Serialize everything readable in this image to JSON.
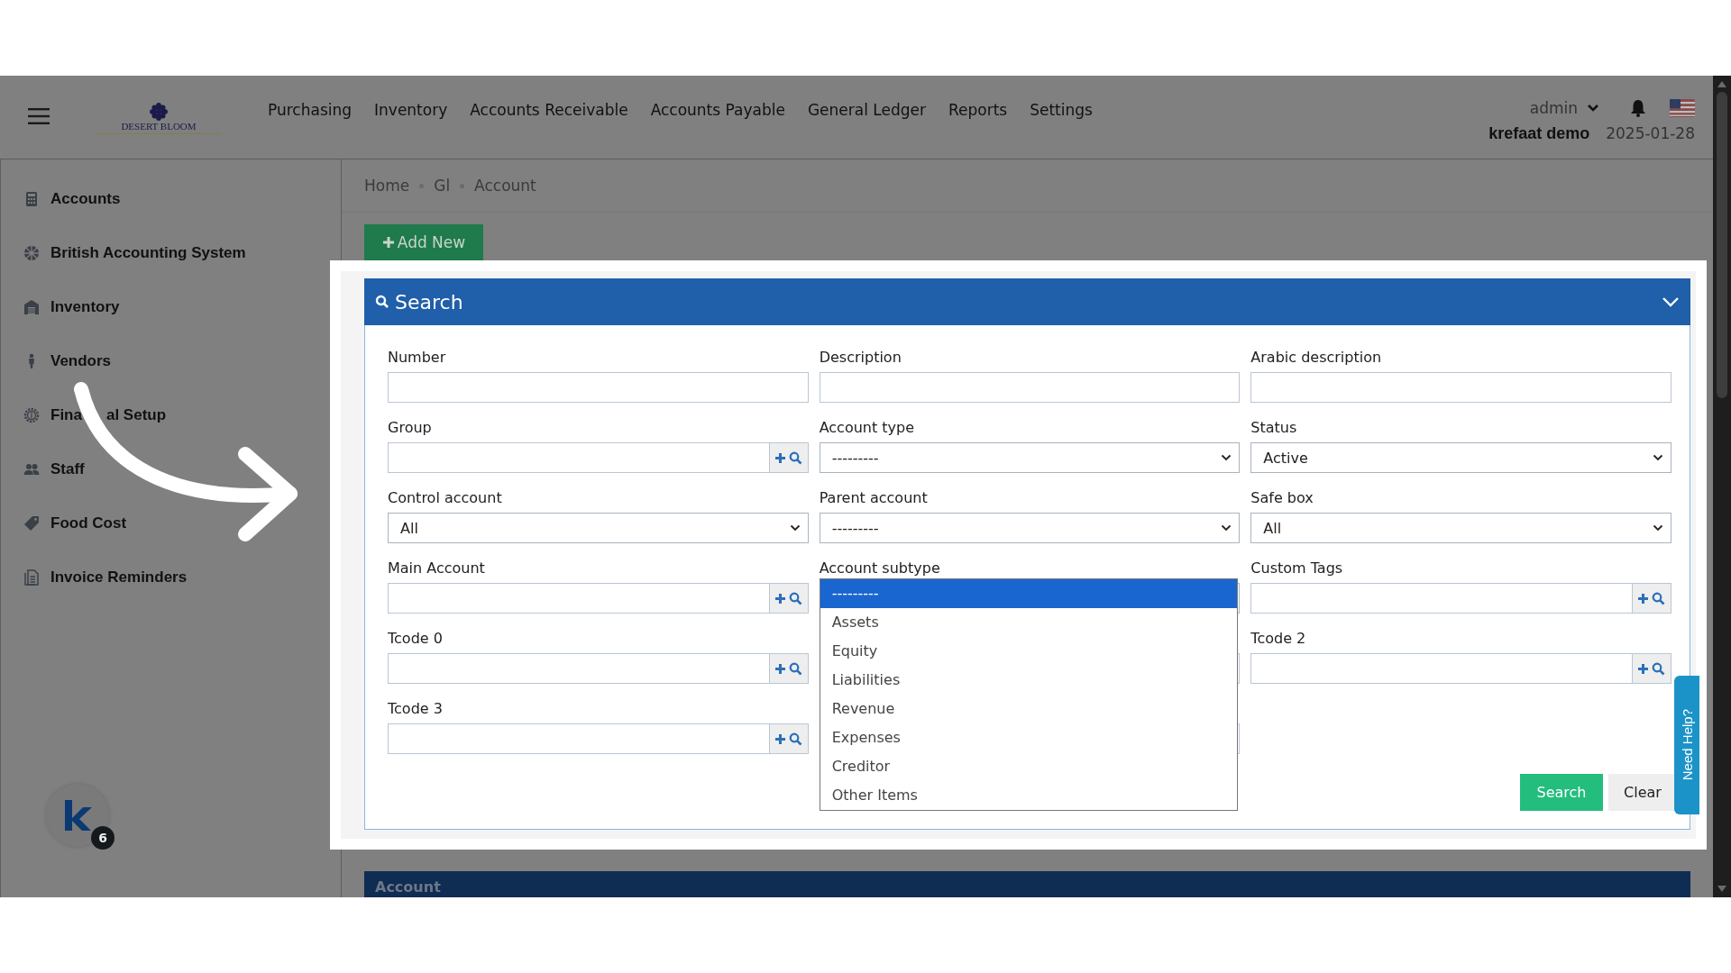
{
  "header": {
    "logo": "DESERT BLOOM",
    "nav": [
      "Purchasing",
      "Inventory",
      "Accounts Receivable",
      "Accounts Payable",
      "General Ledger",
      "Reports",
      "Settings"
    ],
    "user": "admin",
    "company": "krefaat demo",
    "date": "2025-01-28"
  },
  "sidebar": {
    "items": [
      {
        "label": "Accounts",
        "kind": "calculator"
      },
      {
        "label": "British Accounting System",
        "kind": "globe"
      },
      {
        "label": "Inventory",
        "kind": "warehouse"
      },
      {
        "label": "Vendors",
        "kind": "person"
      },
      {
        "label": "Fina",
        "label_rest": "al Setup",
        "kind": "gear"
      },
      {
        "label": "Staff",
        "kind": "people"
      },
      {
        "label": "Food Cost",
        "kind": "tag"
      },
      {
        "label": "Invoice Reminders",
        "kind": "document"
      }
    ],
    "badge": "6"
  },
  "breadcrumb": [
    "Home",
    "Gl",
    "Account"
  ],
  "add_button": "Add New",
  "search_panel": {
    "title": "Search",
    "expanded": true,
    "rows": [
      {
        "cells": [
          {
            "kind": "text",
            "label": "Number"
          },
          {
            "kind": "text",
            "label": "Description"
          },
          {
            "kind": "text",
            "label": "Arabic description"
          }
        ]
      },
      {
        "cells": [
          {
            "kind": "lookup",
            "label": "Group"
          },
          {
            "kind": "select",
            "label": "Account type",
            "value": "---------"
          },
          {
            "kind": "select",
            "label": "Status",
            "value": "Active"
          }
        ]
      },
      {
        "cells": [
          {
            "kind": "select",
            "label": "Control account",
            "value": "All"
          },
          {
            "kind": "select",
            "label": "Parent account",
            "value": "---------"
          },
          {
            "kind": "select",
            "label": "Safe box",
            "value": "All"
          }
        ]
      },
      {
        "cells": [
          {
            "kind": "lookup",
            "label": "Main Account"
          },
          {
            "kind": "open-select",
            "label": "Account subtype"
          },
          {
            "kind": "lookup",
            "label": "Custom Tags"
          }
        ]
      },
      {
        "cells": [
          {
            "kind": "lookup",
            "label": "Tcode 0"
          },
          {
            "kind": "covered"
          },
          {
            "kind": "lookup",
            "label": "Tcode 2"
          }
        ]
      },
      {
        "cells": [
          {
            "kind": "lookup",
            "label": "Tcode 3"
          },
          {
            "kind": "covered"
          }
        ]
      }
    ],
    "dropdown": {
      "options": [
        {
          "label": "---------",
          "selected": true
        },
        {
          "label": "Assets",
          "selected": false
        },
        {
          "label": "Equity",
          "selected": false
        },
        {
          "label": "Liabilities",
          "selected": false
        },
        {
          "label": "Revenue",
          "selected": false
        },
        {
          "label": "Expenses",
          "selected": false
        },
        {
          "label": "Creditor",
          "selected": false
        },
        {
          "label": "Other Items",
          "selected": false
        }
      ]
    },
    "buttons": [
      {
        "label": "Search",
        "kind": "primary"
      },
      {
        "label": "Clear",
        "kind": "secondary"
      }
    ]
  },
  "help_tab": "Need Help?",
  "account_panel": {
    "title": "Account"
  }
}
